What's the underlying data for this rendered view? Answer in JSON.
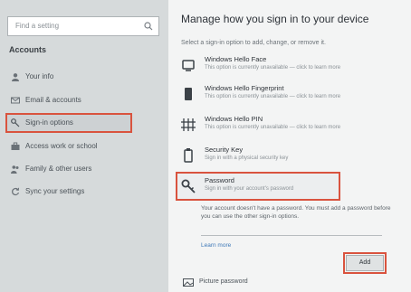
{
  "sidebar": {
    "search_placeholder": "Find a setting",
    "section_title": "Accounts",
    "items": [
      {
        "label": "Your info",
        "icon": "person-icon"
      },
      {
        "label": "Email & accounts",
        "icon": "mail-icon"
      },
      {
        "label": "Sign-in options",
        "icon": "key-icon",
        "active": true
      },
      {
        "label": "Access work or school",
        "icon": "briefcase-icon"
      },
      {
        "label": "Family & other users",
        "icon": "people-icon"
      },
      {
        "label": "Sync your settings",
        "icon": "sync-icon"
      }
    ]
  },
  "main": {
    "title": "Manage how you sign in to your device",
    "subtitle": "Select a sign-in option to add, change, or remove it.",
    "options": [
      {
        "name": "Windows Hello Face",
        "desc": "This option is currently unavailable — click to learn more",
        "icon": "face-icon"
      },
      {
        "name": "Windows Hello Fingerprint",
        "desc": "This option is currently unavailable — click to learn more",
        "icon": "fingerprint-icon"
      },
      {
        "name": "Windows Hello PIN",
        "desc": "This option is currently unavailable — click to learn more",
        "icon": "pin-icon"
      },
      {
        "name": "Security Key",
        "desc": "Sign in with a physical security key",
        "icon": "usb-key-icon"
      },
      {
        "name": "Password",
        "desc": "Sign in with your account's password",
        "icon": "key-icon"
      }
    ],
    "password_expanded_text": "Your account doesn't have a password. You must add a password before you can use the other sign-in options.",
    "learn_more": "Learn more",
    "add_button": "Add",
    "bottom_item": "Picture password"
  },
  "colors": {
    "highlight": "#d9533e",
    "link": "#3f79b8"
  }
}
